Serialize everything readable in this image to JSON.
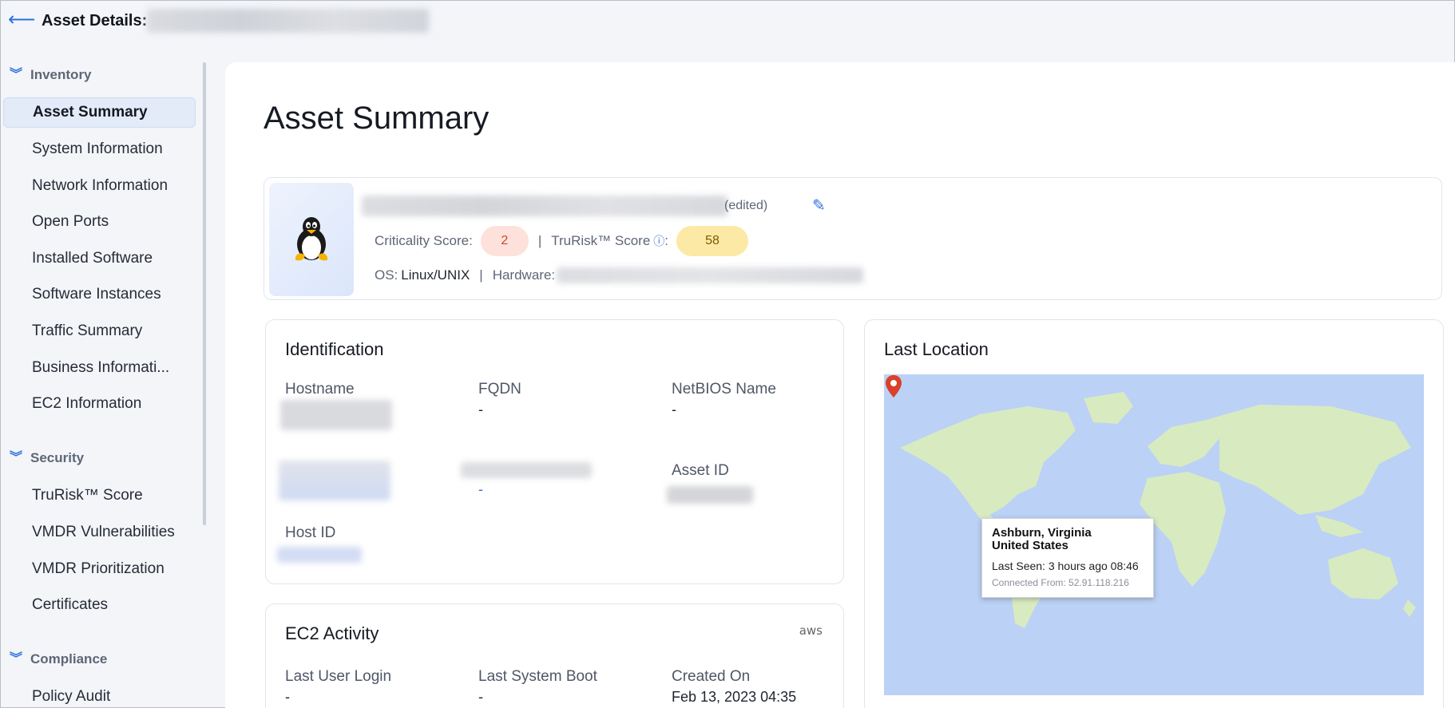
{
  "header": {
    "back_icon": "arrow-left-icon",
    "title": "Asset Details:"
  },
  "sidebar": {
    "sections": [
      {
        "label": "Inventory",
        "items": [
          {
            "label": "Asset Summary",
            "active": true
          },
          {
            "label": "System Information"
          },
          {
            "label": "Network Information"
          },
          {
            "label": "Open Ports"
          },
          {
            "label": "Installed Software"
          },
          {
            "label": "Software Instances"
          },
          {
            "label": "Traffic Summary"
          },
          {
            "label": "Business Informati..."
          },
          {
            "label": "EC2 Information"
          }
        ]
      },
      {
        "label": "Security",
        "items": [
          {
            "label": "TruRisk™ Score"
          },
          {
            "label": "VMDR Vulnerabilities"
          },
          {
            "label": "VMDR Prioritization"
          },
          {
            "label": "Certificates"
          }
        ]
      },
      {
        "label": "Compliance",
        "items": [
          {
            "label": "Policy Audit"
          }
        ]
      }
    ]
  },
  "main": {
    "title": "Asset Summary",
    "summary": {
      "edited_label": "(edited)",
      "criticality_label": "Criticality Score:",
      "criticality_value": "2",
      "separator": "|",
      "trurisk_label": "TruRisk™ Score",
      "trurisk_colon": ":",
      "trurisk_value": "58",
      "os_label": "OS:",
      "os_value": "Linux/UNIX",
      "hardware_label": "Hardware:",
      "os_icon": "linux-tux-icon",
      "colors": {
        "criticality_bg": "#fde1da",
        "trurisk_bg": "#fde9a6",
        "accent": "#2f6fe0"
      }
    },
    "identification": {
      "title": "Identification",
      "hostname_label": "Hostname",
      "fqdn_label": "FQDN",
      "fqdn_value": "-",
      "netbios_label": "NetBIOS Name",
      "netbios_value": "-",
      "row2_value": "-",
      "asset_id_label": "Asset ID",
      "host_id_label": "Host ID"
    },
    "ec2_activity": {
      "title": "EC2 Activity",
      "aws_logo": "aws",
      "last_login_label": "Last User Login",
      "last_login_value": "-",
      "last_boot_label": "Last System Boot",
      "last_boot_value": "-",
      "created_label": "Created On",
      "created_value": "Feb 13, 2023 04:35"
    },
    "last_location": {
      "title": "Last Location",
      "city": "Ashburn, Virginia",
      "country": "United States",
      "last_seen": "Last Seen: 3 hours ago 08:46",
      "connected_from": "Connected From: 52.91.118.216"
    }
  }
}
